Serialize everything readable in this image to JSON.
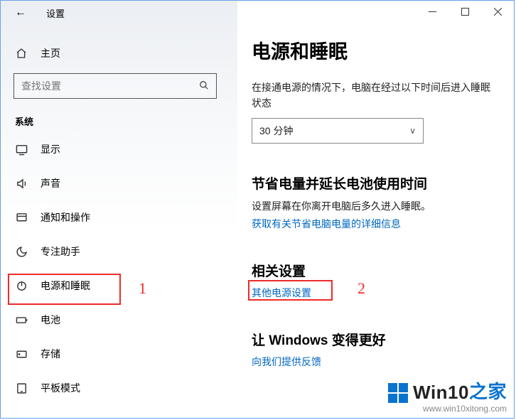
{
  "titlebar": {
    "label": "设置"
  },
  "home": {
    "label": "主页"
  },
  "search": {
    "placeholder": "查找设置"
  },
  "section": {
    "system": "系统"
  },
  "sidebar": {
    "items": [
      {
        "label": "显示"
      },
      {
        "label": "声音"
      },
      {
        "label": "通知和操作"
      },
      {
        "label": "专注助手"
      },
      {
        "label": "电源和睡眠"
      },
      {
        "label": "电池"
      },
      {
        "label": "存储"
      },
      {
        "label": "平板模式"
      }
    ]
  },
  "main": {
    "title": "电源和睡眠",
    "sleep": {
      "desc": "在接通电源的情况下，电脑在经过以下时间后进入睡眠状态",
      "value": "30 分钟"
    },
    "save": {
      "heading": "节省电量并延长电池使用时间",
      "desc": "设置屏幕在你离开电脑后多久进入睡眠。",
      "link": "获取有关节省电脑电量的详细信息"
    },
    "related": {
      "heading": "相关设置",
      "link": "其他电源设置"
    },
    "better": {
      "heading": "让 Windows 变得更好",
      "link": "向我们提供反馈"
    }
  },
  "annotations": {
    "a1": "1",
    "a2": "2"
  },
  "watermark": {
    "brand_a": "Win10",
    "brand_b": "之家",
    "url": "www.win10xitong.com"
  }
}
